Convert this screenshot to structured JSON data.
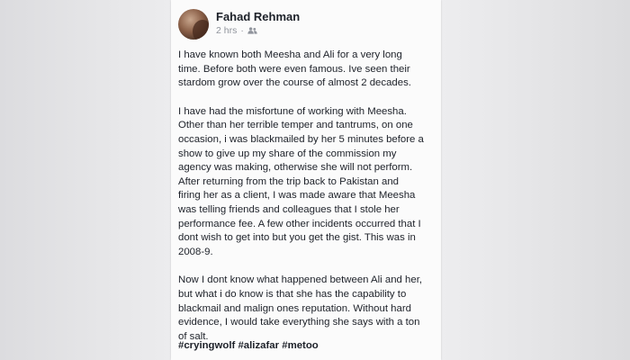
{
  "post": {
    "author": "Fahad Rehman",
    "timestamp": "2 hrs",
    "separator": "·",
    "audience_icon": "friends-icon",
    "paragraphs": [
      {
        "lines": [
          "I have known both Meesha and Ali for a very long",
          "time. Before both were even famous. Ive seen their",
          "stardom grow over the course of almost 2 decades."
        ]
      },
      {
        "lines": [
          "I have had the misfortune of working with Meesha.",
          "Other than her terrible temper and tantrums, on one",
          "occasion, i was blackmailed by her 5 minutes before a",
          "show to give up my share of the commission my",
          "agency was making, otherwise she will not perform.",
          "After returning from the trip back to Pakistan and",
          "firing her as a client, I was made aware that Meesha",
          "was telling friends and colleagues that I stole her",
          "performance fee. A few other incidents occurred that I",
          "dont wish to get into but you get the gist. This was in",
          "2008-9."
        ]
      },
      {
        "lines": [
          "Now I dont know what happened between Ali and her,",
          "but what i do know is that she has the capability to",
          "blackmail and malign ones reputation. Without hard",
          "evidence, I would take everything she says with a ton",
          "of salt."
        ]
      }
    ],
    "hashtags": [
      "#cryingwolf",
      "#alizafar",
      "#metoo"
    ]
  },
  "colors": {
    "text": "#1d2129",
    "meta": "#90949c",
    "card": "#fbfbfb",
    "background": "#e9e9eb"
  }
}
